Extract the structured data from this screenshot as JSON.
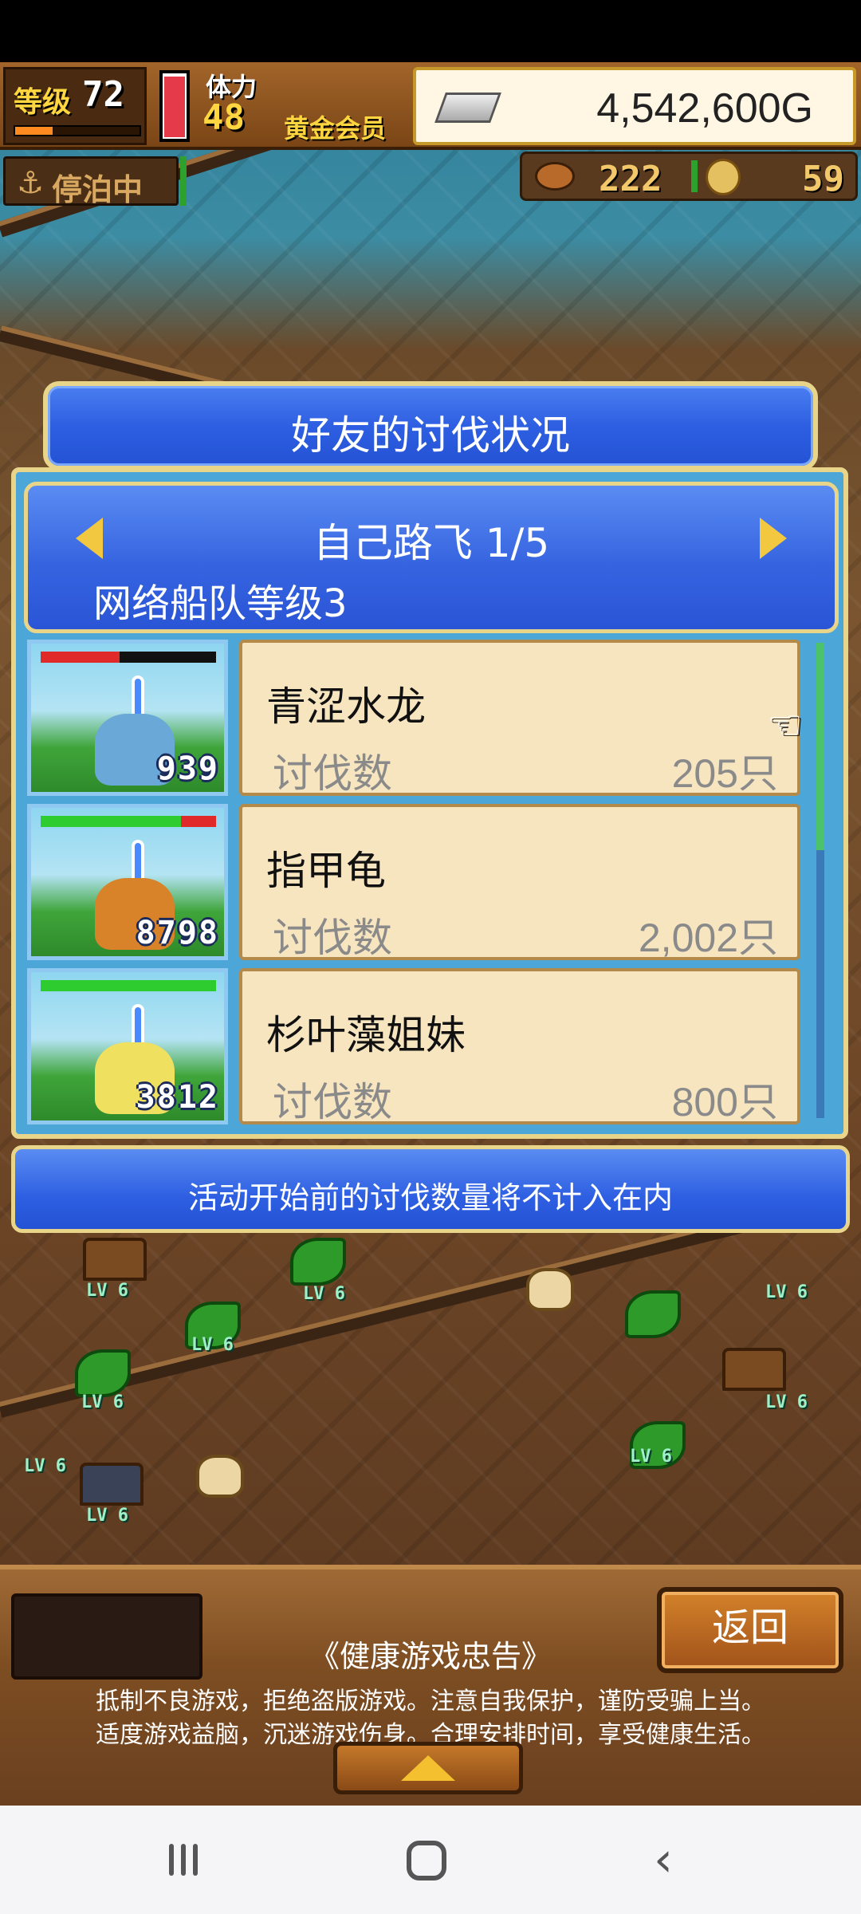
{
  "hud": {
    "level_label": "等级",
    "level_value": "72",
    "stamina_label": "体力",
    "stamina_value": "48",
    "member_label": "黄金会员",
    "gold": "4,542,600G"
  },
  "subhud": {
    "dock_status": "停泊中",
    "meat_count": "222",
    "coin_count": "59"
  },
  "dialog": {
    "title": "好友的讨伐状况",
    "friend_name": "自己路飞 1/5",
    "fleet_level": "网络船队等级3",
    "count_label": "讨伐数",
    "items": [
      {
        "name": "青涩水龙",
        "count": "205只",
        "level": "939",
        "hp_fraction": 0.45,
        "hp_color": "#e02a2a",
        "creature_color": "#6aa8d8"
      },
      {
        "name": "指甲龟",
        "count": "2,002只",
        "level": "8798",
        "hp_fraction": 0.8,
        "hp_color": "#2ecc2e",
        "creature_color": "#d8822a"
      },
      {
        "name": "杉叶藻姐妹",
        "count": "800只",
        "level": "3812",
        "hp_fraction": 1.0,
        "hp_color": "#2ecc2e",
        "creature_color": "#f0e060"
      }
    ],
    "notice": "活动开始前的讨伐数量将不计入在内"
  },
  "map_level_tag": "LV 6",
  "bottom": {
    "back_label": "返回",
    "health_title": "《健康游戏忠告》",
    "health_line1": "抵制不良游戏，拒绝盗版游戏。注意自我保护，谨防受骗上当。",
    "health_line2": "适度游戏益脑，沉迷游戏伤身。合理安排时间，享受健康生活。"
  }
}
